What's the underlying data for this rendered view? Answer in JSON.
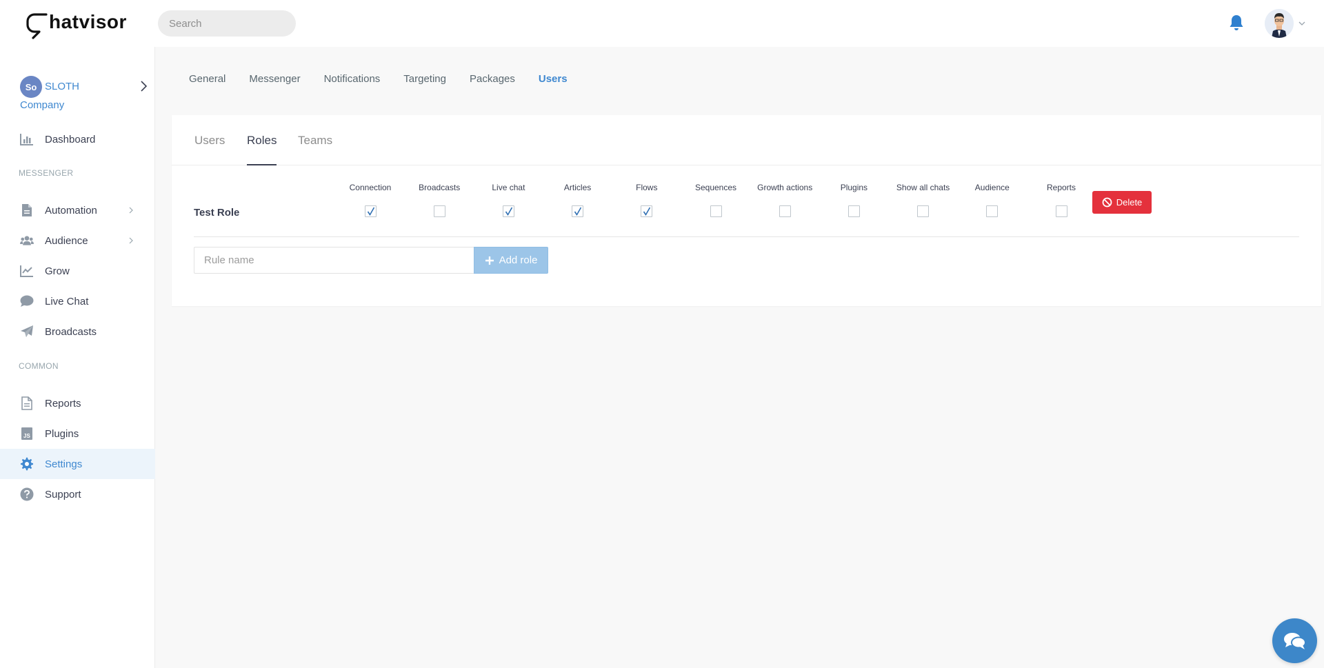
{
  "header": {
    "logo_text": "hatvisor",
    "search_placeholder": "Search"
  },
  "sidebar": {
    "company": {
      "logo_initials": "So",
      "name_line1": "SLOTH",
      "name_line2": "Company"
    },
    "items": [
      {
        "label": "Dashboard",
        "icon": "bar-chart-icon"
      },
      {
        "label": "Automation",
        "icon": "document-icon"
      },
      {
        "label": "Audience",
        "icon": "users-icon"
      },
      {
        "label": "Grow",
        "icon": "trend-chart-icon"
      },
      {
        "label": "Live Chat",
        "icon": "chat-bubble-icon"
      },
      {
        "label": "Broadcasts",
        "icon": "paper-plane-icon"
      },
      {
        "label": "Reports",
        "icon": "file-text-icon"
      },
      {
        "label": "Plugins",
        "icon": "js-file-icon"
      },
      {
        "label": "Settings",
        "icon": "gear-icon"
      },
      {
        "label": "Support",
        "icon": "question-circle-icon"
      }
    ],
    "sections": {
      "messenger": "MESSENGER",
      "common": "COMMON"
    },
    "active_item": "Settings"
  },
  "settings_tabs": [
    "General",
    "Messenger",
    "Notifications",
    "Targeting",
    "Packages",
    "Users"
  ],
  "active_settings_tab": "Users",
  "sub_tabs": [
    "Users",
    "Roles",
    "Teams"
  ],
  "active_sub_tab": "Roles",
  "roles": {
    "permissions": [
      "Connection",
      "Broadcasts",
      "Live chat",
      "Articles",
      "Flows",
      "Sequences",
      "Growth actions",
      "Plugins",
      "Show all chats",
      "Audience",
      "Reports"
    ],
    "rows": [
      {
        "name": "Test Role",
        "checked": [
          true,
          false,
          true,
          true,
          true,
          false,
          false,
          false,
          false,
          false,
          false
        ]
      }
    ],
    "delete_label": "Delete",
    "rule_placeholder": "Rule name",
    "add_label": "Add role"
  },
  "colors": {
    "accent": "#3f88d0",
    "danger": "#e4313c",
    "add_button": "#9cc5e8",
    "active_nav_bg": "#ecf4fb"
  }
}
